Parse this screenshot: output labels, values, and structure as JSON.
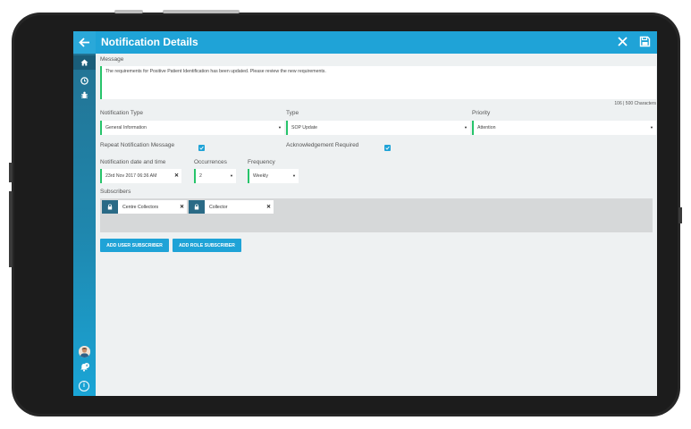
{
  "header": {
    "title": "Notification Details"
  },
  "message": {
    "label": "Message",
    "text": "The requirements for Positive Patient Identification has been updated. Please review the new requirements.",
    "counter": "106 | 500 Characters"
  },
  "fields": {
    "notification_type": {
      "label": "Notification Type",
      "value": "General Information"
    },
    "type": {
      "label": "Type",
      "value": "SOP Update"
    },
    "priority": {
      "label": "Priority",
      "value": "Attention"
    },
    "repeat": {
      "label": "Repeat Notification Message",
      "checked": true
    },
    "ack": {
      "label": "Acknowledgement Required",
      "checked": true
    },
    "date": {
      "label": "Notification date and time",
      "value": "23rd Nov 2017 06:36 AM"
    },
    "occurrences": {
      "label": "Occurrences",
      "value": "2"
    },
    "frequency": {
      "label": "Frequency",
      "value": "Weekly"
    }
  },
  "subscribers": {
    "label": "Subscribers",
    "chips": [
      {
        "name": "Centre Collectors"
      },
      {
        "name": "Collector"
      }
    ]
  },
  "buttons": {
    "add_user": "ADD USER SUBSCRIBER",
    "add_role": "ADD ROLE SUBSCRIBER"
  },
  "sidebar": {
    "notification_count": "4",
    "icons": [
      "back-arrow-icon",
      "home-icon",
      "clock-icon",
      "bug-icon",
      "avatar",
      "bell-icon",
      "info-icon"
    ]
  },
  "colors": {
    "accent": "#1fa3d7",
    "field_marker": "#27c46b",
    "sidebar_dark": "#23708f"
  }
}
